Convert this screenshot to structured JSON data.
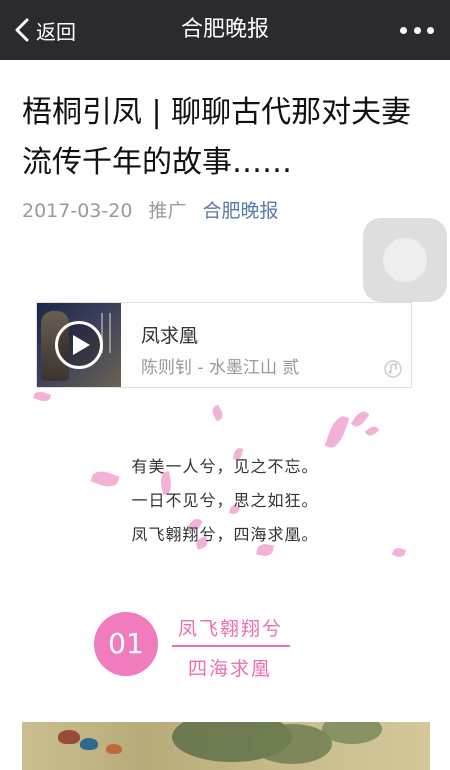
{
  "navbar": {
    "back_label": "返回",
    "title": "合肥晚报"
  },
  "article": {
    "title": "梧桐引凤 | 聊聊古代那对夫妻流传千年的故事……",
    "date": "2017-03-20",
    "tag": "推广",
    "author": "合肥晚报"
  },
  "music": {
    "title": "凤求凰",
    "artist": "陈则钊 - 水墨江山 贰"
  },
  "poem": {
    "lines": [
      "有美一人兮，见之不忘。",
      "一日不见兮，思之如狂。",
      "凤飞翱翔兮，四海求凰。"
    ]
  },
  "section": {
    "number": "01",
    "heading": "凤飞翱翔兮",
    "subheading": "四海求凰"
  },
  "colors": {
    "navbar": "#2b2b2f",
    "author_link": "#5b7aa9",
    "accent_pink": "#ec6fb3",
    "circle_pink": "#f07cbd"
  },
  "icons": [
    "back-chevron-icon",
    "more-icon",
    "play-icon",
    "music-note-icon"
  ]
}
